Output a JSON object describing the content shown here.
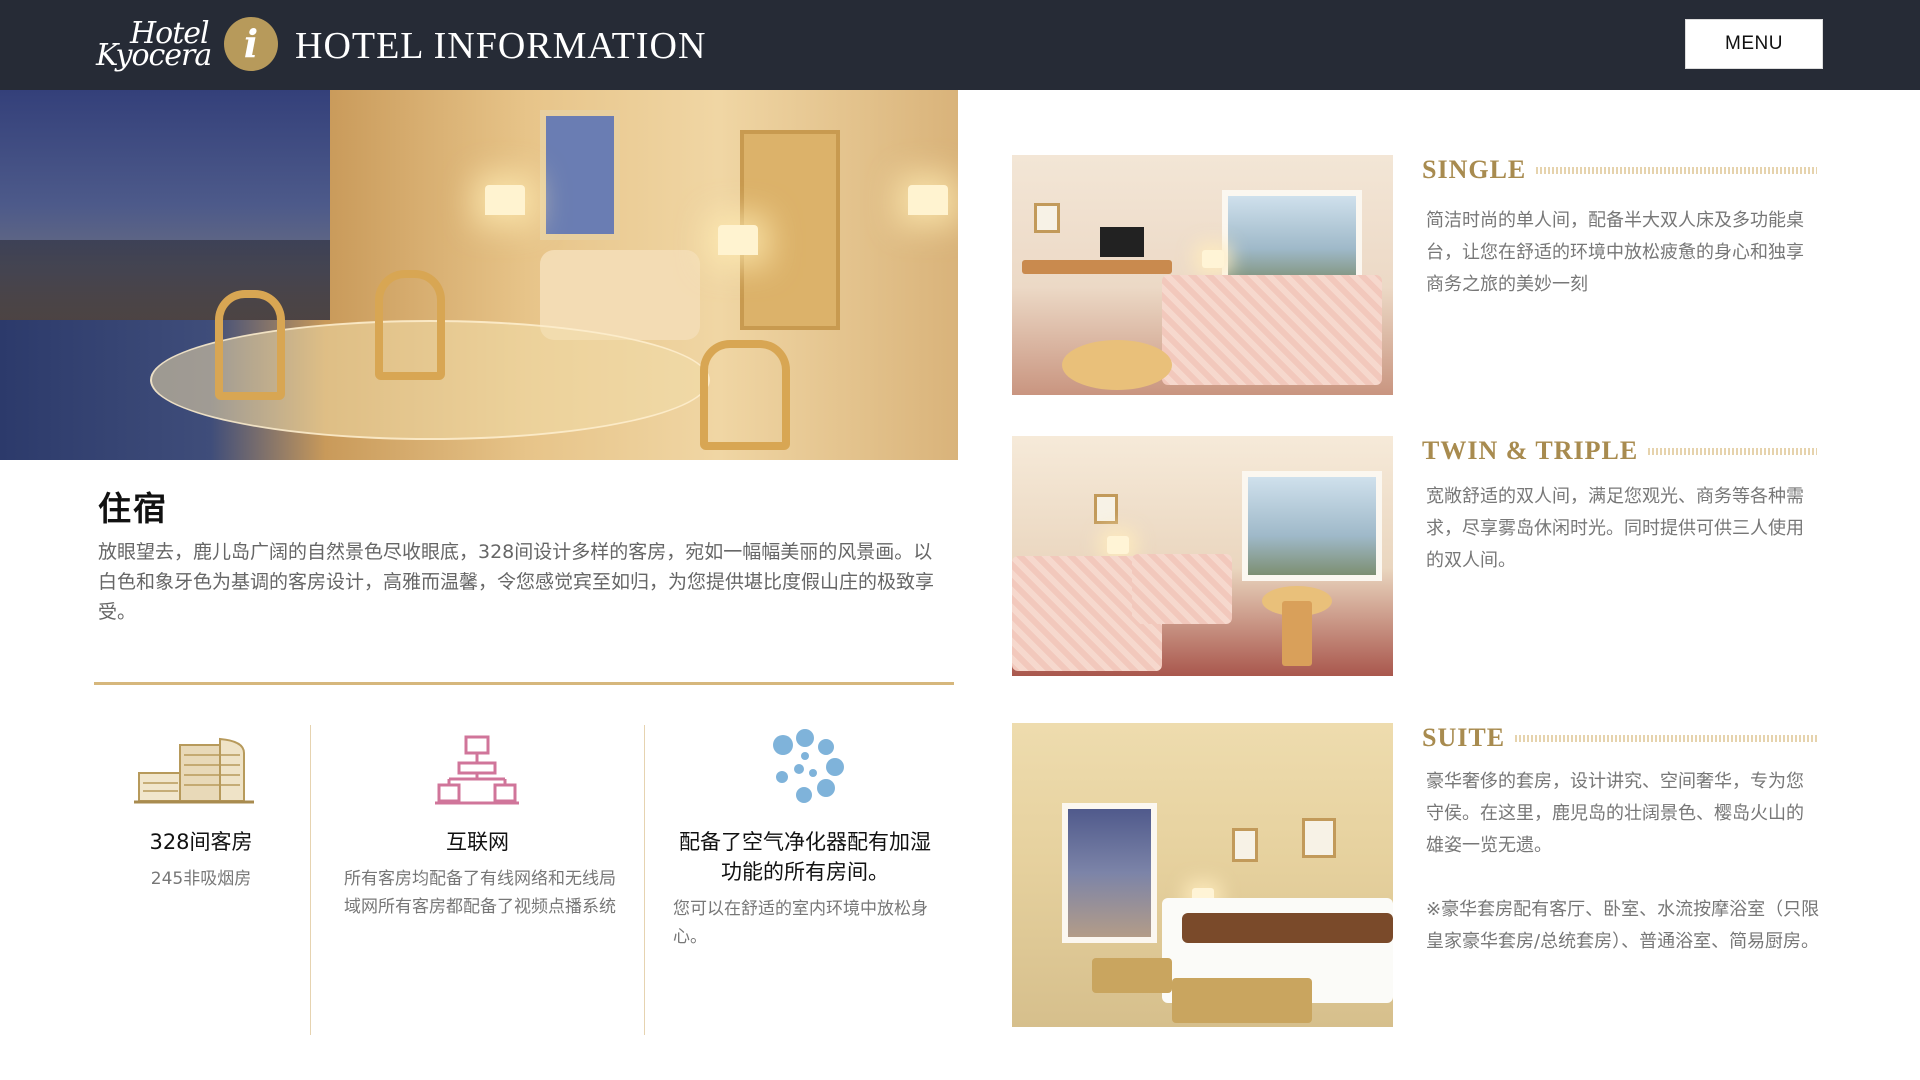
{
  "header": {
    "logo_line1": "Hotel",
    "logo_line2": "Kyocera",
    "info_glyph": "i",
    "title": "HOTEL INFORMATION",
    "menu_label": "MENU"
  },
  "colors": {
    "header_bg": "#262b36",
    "gold_accent": "#b79a5b",
    "room_title_gold": "#a88b4f",
    "divider_gold": "#d6b77c"
  },
  "section": {
    "title": "住宿",
    "description": "放眼望去，鹿儿岛广阔的自然景色尽收眼底，328间设计多样的客房，宛如一幅幅美丽的风景画。以白色和象牙色为基调的客房设计，高雅而温馨，令您感觉宾至如归，为您提供堪比度假山庄的极致享受。"
  },
  "features": [
    {
      "icon": "hotel-building-icon",
      "title": "328间客房",
      "subtitle": "245非吸烟房"
    },
    {
      "icon": "network-icon",
      "title": "互联网",
      "subtitle": "所有客房均配备了有线网络和无线局域网所有客房都配备了视频点播系统"
    },
    {
      "icon": "air-purifier-icon",
      "title": "配备了空气净化器配有加湿功能的所有房间。",
      "subtitle": "您可以在舒适的室内环境中放松身心。"
    }
  ],
  "rooms": [
    {
      "name": "SINGLE",
      "description": "简洁时尚的单人间，配备半大双人床及多功能桌台，让您在舒适的环境中放松疲惫的身心和独享商务之旅的美妙一刻"
    },
    {
      "name": "TWIN & TRIPLE",
      "description": "宽敞舒适的双人间，满足您观光、商务等各种需求，尽享雾岛休闲时光。同时提供可供三人使用的双人间。"
    },
    {
      "name": "SUITE",
      "description": "豪华奢侈的套房，设计讲究、空间奢华，专为您守侯。在这里，鹿児岛的壮阔景色、樱岛火山的雄姿一览无遗。",
      "note": "※豪华套房配有客厅、卧室、水流按摩浴室（只限皇家豪华套房/总统套房）、普通浴室、简易厨房。"
    }
  ]
}
